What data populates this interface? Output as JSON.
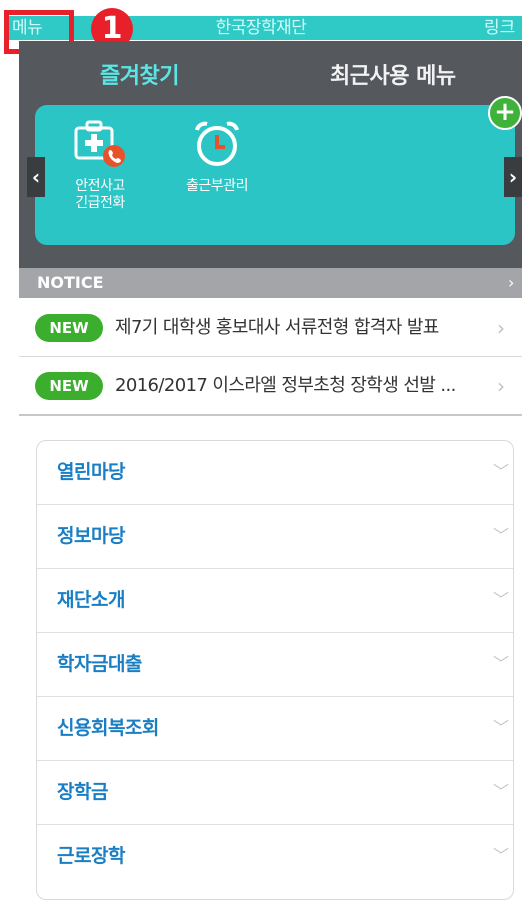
{
  "header": {
    "menu_label": "메뉴",
    "title": "한국장학재단",
    "link_label": "링크",
    "step_number": "1"
  },
  "favorites": {
    "tabs": [
      "즐겨찾기",
      "최근사용 메뉴"
    ],
    "active_tab": "즐겨찾기",
    "shortcuts": [
      {
        "label": "안전사고\n긴급전화",
        "icon": "medical-kit-phone-icon"
      },
      {
        "label": "출근부관리",
        "icon": "alarm-clock-icon"
      }
    ],
    "add_icon": "plus-icon"
  },
  "notice": {
    "title": "NOTICE",
    "items": [
      {
        "badge": "NEW",
        "text": "제7기 대학생 홍보대사 서류전형 합격자 발표"
      },
      {
        "badge": "NEW",
        "text": "2016/2017 이스라엘 정부초청 장학생 선발 ..."
      }
    ]
  },
  "menu": {
    "items": [
      "열린마당",
      "정보마당",
      "재단소개",
      "학자금대출",
      "신용회복조회",
      "장학금",
      "근로장학"
    ]
  },
  "colors": {
    "accent": "#2fc9c6",
    "highlight": "#e8202a",
    "badge_green": "#3cae2e",
    "menu_text": "#1a7ec4"
  }
}
